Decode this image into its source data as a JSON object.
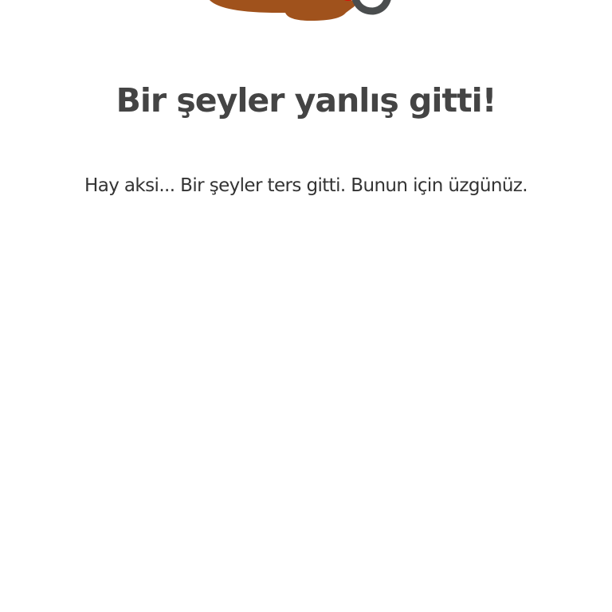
{
  "error": {
    "title": "Bir şeyler yanlış gitti!",
    "message": "Hay aksi... Bir şeyler ters gitti. Bunun için üzgünüz."
  },
  "colors": {
    "background": "#ffffff",
    "title_text": "#444444",
    "body_text": "#333333",
    "puddle_brown": "#a0521c",
    "cup_gray": "#4a4d4e",
    "accent_red": "#e60000"
  },
  "illustration": {
    "icon": "spilled-cup-icon"
  }
}
